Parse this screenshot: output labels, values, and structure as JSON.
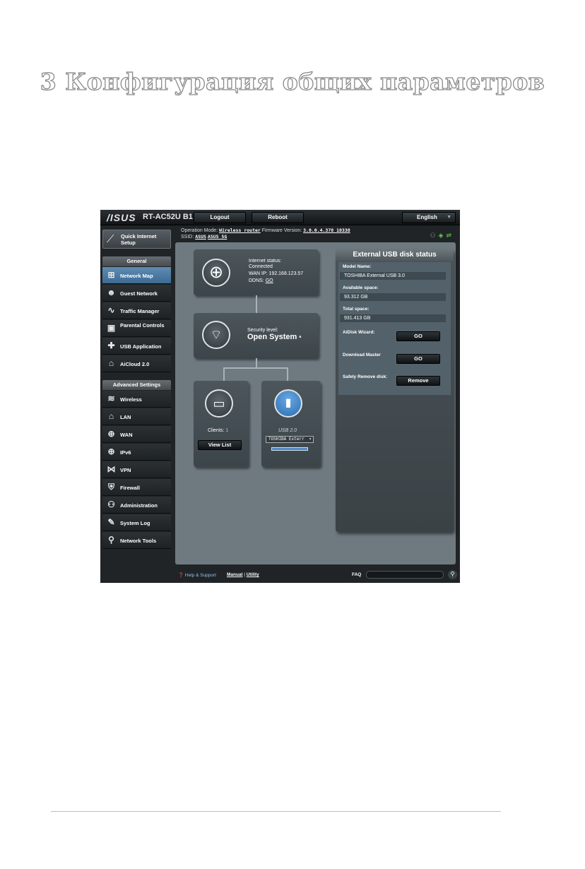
{
  "page": {
    "heading": "3 Конфигурация общих параметров"
  },
  "router": {
    "brand": "/ISUS",
    "model": "RT-AC52U B1",
    "top_buttons": {
      "logout": "Logout",
      "reboot": "Reboot"
    },
    "language": "English",
    "info": {
      "op_mode_label": "Operation Mode:",
      "op_mode_value": "Wireless router",
      "fw_label": "Firmware Version:",
      "fw_value": "3.0.0.4.378_10338",
      "ssid_label": "SSID:",
      "ssid_1": "ASUS",
      "ssid_2": "ASUS_5G"
    },
    "sidebar": {
      "quick_setup": "Quick Internet Setup",
      "general_header": "General",
      "general_items": [
        {
          "label": "Network Map",
          "icon": "network-map-icon",
          "active": true
        },
        {
          "label": "Guest Network",
          "icon": "guest-network-icon"
        },
        {
          "label": "Traffic Manager",
          "icon": "traffic-manager-icon"
        },
        {
          "label": "Parental Controls",
          "icon": "lock-icon"
        },
        {
          "label": "USB Application",
          "icon": "puzzle-icon"
        },
        {
          "label": "AiCloud 2.0",
          "icon": "cloud-home-icon"
        }
      ],
      "advanced_header": "Advanced Settings",
      "advanced_items": [
        {
          "label": "Wireless",
          "icon": "wifi-icon"
        },
        {
          "label": "LAN",
          "icon": "house-icon"
        },
        {
          "label": "WAN",
          "icon": "globe-icon"
        },
        {
          "label": "IPv6",
          "icon": "globe-ipv6-icon"
        },
        {
          "label": "VPN",
          "icon": "vpn-icon"
        },
        {
          "label": "Firewall",
          "icon": "shield-icon"
        },
        {
          "label": "Administration",
          "icon": "user-icon"
        },
        {
          "label": "System Log",
          "icon": "log-icon"
        },
        {
          "label": "Network Tools",
          "icon": "tools-icon"
        }
      ]
    },
    "map": {
      "internet": {
        "status_label": "Internet status:",
        "status_value": "Connected",
        "wan_ip_label": "WAN IP:",
        "wan_ip_value": "192.168.123.57",
        "ddns_label": "DDNS:",
        "ddns_value": "GO"
      },
      "router_node": {
        "security_label": "Security level:",
        "security_value": "Open System"
      },
      "clients": {
        "label": "Clients:",
        "count": "1",
        "button": "View List"
      },
      "usb": {
        "label": "USB 2.0",
        "device": "TOSHIBA Exterr",
        "usage_fraction": 1.0
      }
    },
    "usb_panel": {
      "title": "External USB disk status",
      "model_label": "Model Name:",
      "model_value": "TOSHIBA External USB 3.0",
      "available_label": "Available space:",
      "available_value": "93.312 GB",
      "total_label": "Total space:",
      "total_value": "931.413 GB",
      "aidisk_label": "AiDisk Wizard:",
      "aidisk_button": "GO",
      "download_label": "Download Master",
      "download_button": "GO",
      "remove_label": "Safely Remove disk:",
      "remove_button": "Remove"
    },
    "footer": {
      "help": "Help & Support",
      "manual": "Manual",
      "separator": " | ",
      "utility": "Utility",
      "faq": "FAQ"
    }
  }
}
